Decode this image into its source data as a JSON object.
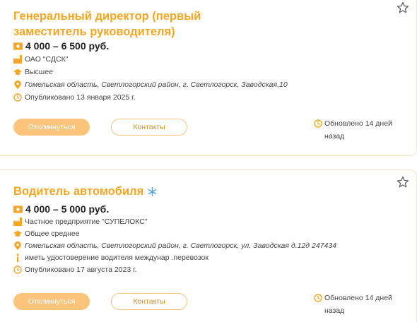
{
  "colors": {
    "accent": "#f5a623",
    "button_fill": "#fcc37a",
    "border": "#f2e3c4"
  },
  "vacancies": [
    {
      "title": "Генеральный директор (первый заместитель руководителя)",
      "salary": "4 000 – 6 500 руб.",
      "company": "ОАО \"СДСК\"",
      "education": "Высшее",
      "address": "Гомельская область, Светлогорский район, г. Светлогорск, Заводская,10",
      "published": "Опубликовано 13 января 2025 г.",
      "apply_label": "Откликнуться",
      "contacts_label": "Контакты",
      "updated_line1": "Обновлено 14 дней",
      "updated_line2": "назад"
    },
    {
      "title": "Водитель автомобиля",
      "salary": "4 000 – 5 000 руб.",
      "company": "Частное предприятие \"СУПЕЛОКС\"",
      "education": "Общее среднее",
      "address": "Гомельская область, Светлогорский район, г. Светлогорск, ул. Заводская д.12д 247434",
      "note": "иметь удостоверение водителя междунар .перевозок",
      "published": "Опубликовано 17 августа 2023 г.",
      "apply_label": "Откликнуться",
      "contacts_label": "Контакты",
      "updated_line1": "Обновлено 14 дней",
      "updated_line2": "назад"
    }
  ],
  "icons": [
    "star-icon",
    "salary-icon",
    "company-icon",
    "education-icon",
    "location-icon",
    "clock-icon",
    "info-icon",
    "snowflake-icon"
  ]
}
